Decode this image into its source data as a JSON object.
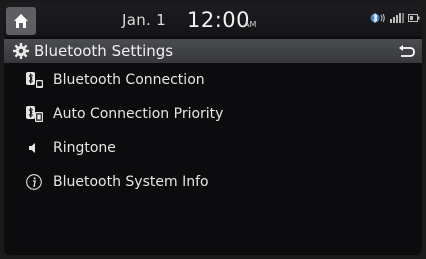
{
  "status_bar": {
    "date": "Jan.  1",
    "time": "12:00",
    "ampm": "AM",
    "icons": [
      "home-icon",
      "bluetooth-audio-icon",
      "signal-icon",
      "battery-icon"
    ]
  },
  "header": {
    "title": "Bluetooth Settings",
    "icons": [
      "gear-icon",
      "back-icon"
    ]
  },
  "menu": {
    "items": [
      {
        "label": "Bluetooth Connection",
        "icon": "bluetooth-connection-icon"
      },
      {
        "label": "Auto Connection Priority",
        "icon": "auto-connection-priority-icon"
      },
      {
        "label": "Ringtone",
        "icon": "speaker-icon"
      },
      {
        "label": "Bluetooth System Info",
        "icon": "info-icon"
      }
    ]
  },
  "colors": {
    "background": "#0c0c0e",
    "header": "#404246",
    "home_button": "#5d5f63",
    "text": "#e6e6e6"
  }
}
